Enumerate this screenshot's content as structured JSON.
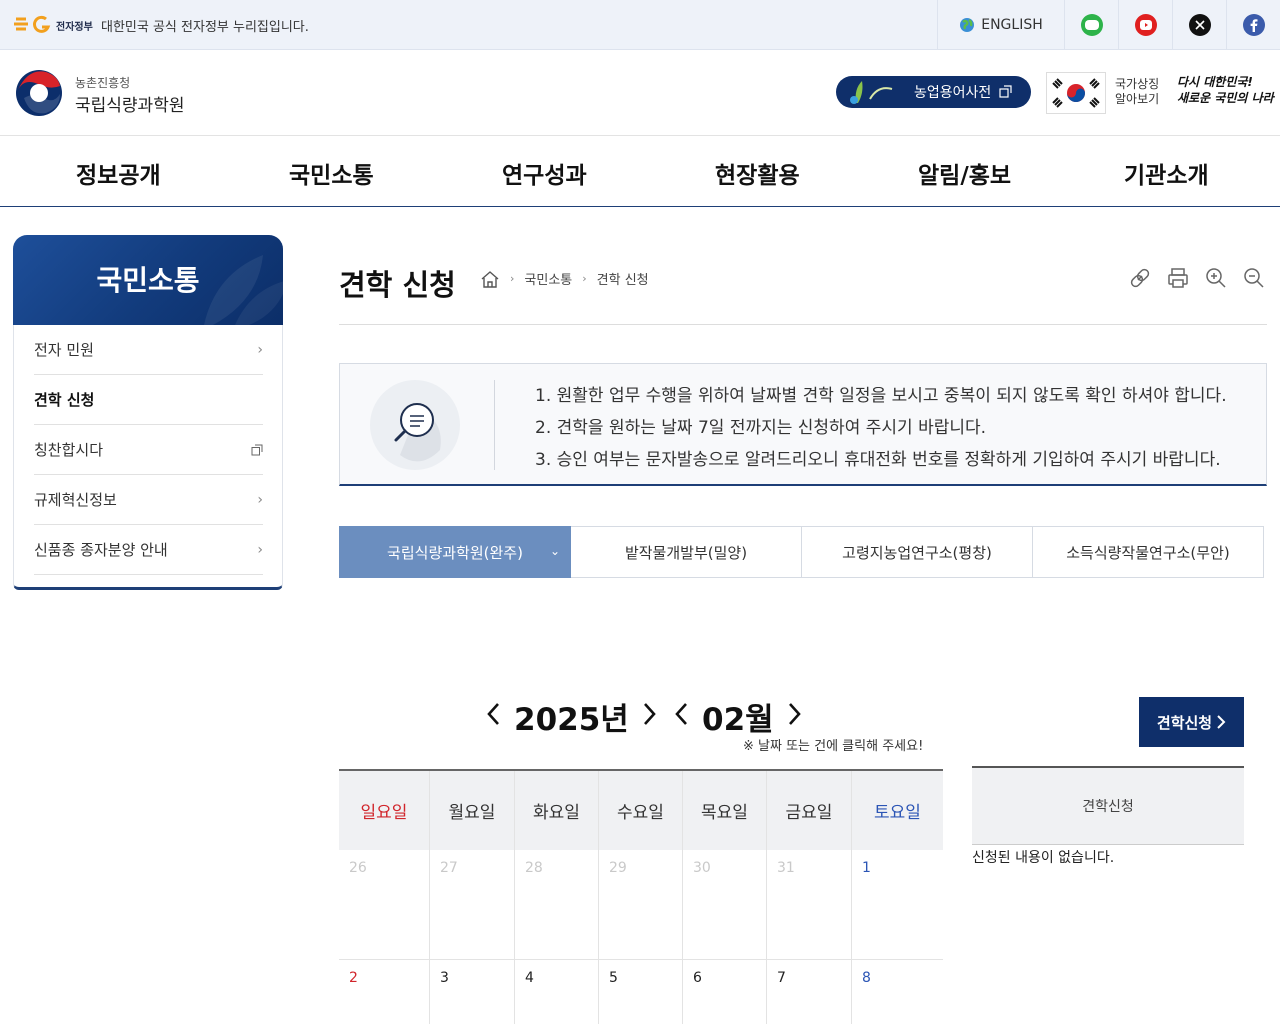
{
  "gov_bar": {
    "small_label": "전자정부",
    "text": "대한민국 공식 전자정부 누리집입니다.",
    "english_label": "ENGLISH",
    "sns": [
      "line-icon",
      "youtube-icon",
      "x-icon",
      "facebook-icon"
    ],
    "sns_colors": [
      "#2db34a",
      "#e02020",
      "#111111",
      "#3b5bab"
    ]
  },
  "header": {
    "org_sub": "농촌진흥청",
    "org_main": "국립식량과학원",
    "dict_label": "농업용어사전",
    "flag_label_1": "국가상징",
    "flag_label_2": "알아보기",
    "slogan_1": "다시 대한민국!",
    "slogan_2": "새로운 국민의 나라"
  },
  "nav": [
    "정보공개",
    "국민소통",
    "연구성과",
    "현장활용",
    "알림/홍보",
    "기관소개"
  ],
  "sidebar": {
    "title": "국민소통",
    "items": [
      {
        "label": "전자 민원",
        "icon": "chevron-right-icon"
      },
      {
        "label": "견학 신청",
        "icon": ""
      },
      {
        "label": "칭찬합시다",
        "icon": "external-link-icon"
      },
      {
        "label": "규제혁신정보",
        "icon": "chevron-right-icon"
      },
      {
        "label": "신품종 종자분양 안내",
        "icon": "chevron-right-icon"
      }
    ]
  },
  "content": {
    "title": "견학 신청",
    "breadcrumb": [
      "국민소통",
      "견학 신청"
    ],
    "info_lines": [
      "1. 원활한 업무 수행을 위하여 날짜별 견학 일정을 보시고 중복이 되지 않도록 확인 하셔야 합니다.",
      "2. 견학을 원하는 날짜 7일 전까지는 신청하여 주시기 바랍니다.",
      "3. 승인 여부는 문자발송으로 알려드리오니 휴대전화 번호를 정확하게 기입하여 주시기 바랍니다."
    ],
    "tabs": [
      "국립식량과학원(완주)",
      "밭작물개발부(밀양)",
      "고령지농업연구소(평창)",
      "소득식량작물연구소(무안)"
    ]
  },
  "calendar": {
    "year_label": "2025년",
    "month_label": "02월",
    "note": "※ 날짜 또는 건에 클릭해 주세요!",
    "apply_label": "견학신청",
    "weekdays": [
      "일요일",
      "월요일",
      "화요일",
      "수요일",
      "목요일",
      "금요일",
      "토요일"
    ],
    "week1": [
      "26",
      "27",
      "28",
      "29",
      "30",
      "31",
      "1"
    ],
    "week2": [
      "2",
      "3",
      "4",
      "5",
      "6",
      "7",
      "8"
    ]
  },
  "apply_list": {
    "header": "견학신청",
    "empty": "신청된 내용이 없습니다."
  },
  "colors": {
    "navy": "#0f2f6a",
    "tab_active": "#6b8ebf",
    "sunday": "#d1252b",
    "saturday": "#2b55b5"
  }
}
